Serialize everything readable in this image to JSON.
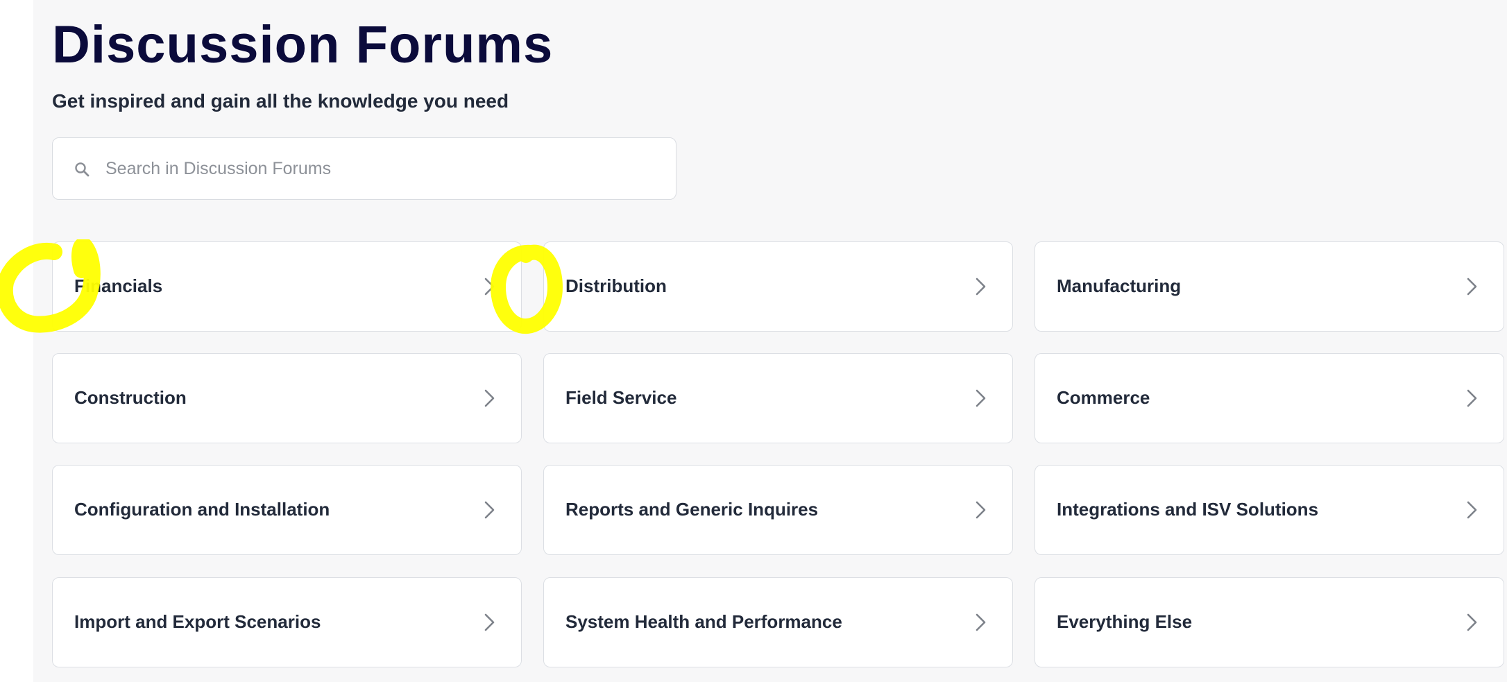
{
  "page": {
    "title": "Discussion Forums",
    "subtitle": "Get inspired and gain all the knowledge you need"
  },
  "search": {
    "placeholder": "Search in Discussion Forums",
    "value": "",
    "icon": "search-icon"
  },
  "categories": [
    {
      "label": "Financials",
      "icon": "chevron-right-icon"
    },
    {
      "label": "Distribution",
      "icon": "chevron-right-icon"
    },
    {
      "label": "Manufacturing",
      "icon": "chevron-right-icon"
    },
    {
      "label": "Construction",
      "icon": "chevron-right-icon"
    },
    {
      "label": "Field Service",
      "icon": "chevron-right-icon"
    },
    {
      "label": "Commerce",
      "icon": "chevron-right-icon"
    },
    {
      "label": "Configuration and Installation",
      "icon": "chevron-right-icon"
    },
    {
      "label": "Reports and Generic Inquires",
      "icon": "chevron-right-icon"
    },
    {
      "label": "Integrations and ISV Solutions",
      "icon": "chevron-right-icon"
    },
    {
      "label": "Import and Export Scenarios",
      "icon": "chevron-right-icon"
    },
    {
      "label": "System Health and Performance",
      "icon": "chevron-right-icon"
    },
    {
      "label": "Everything Else",
      "icon": "chevron-right-icon"
    }
  ],
  "colors": {
    "title": "#0b0b3b",
    "text": "#222a3a",
    "background": "#f7f7f8",
    "card_border": "#dcdfe4",
    "highlight": "#ffff00"
  }
}
